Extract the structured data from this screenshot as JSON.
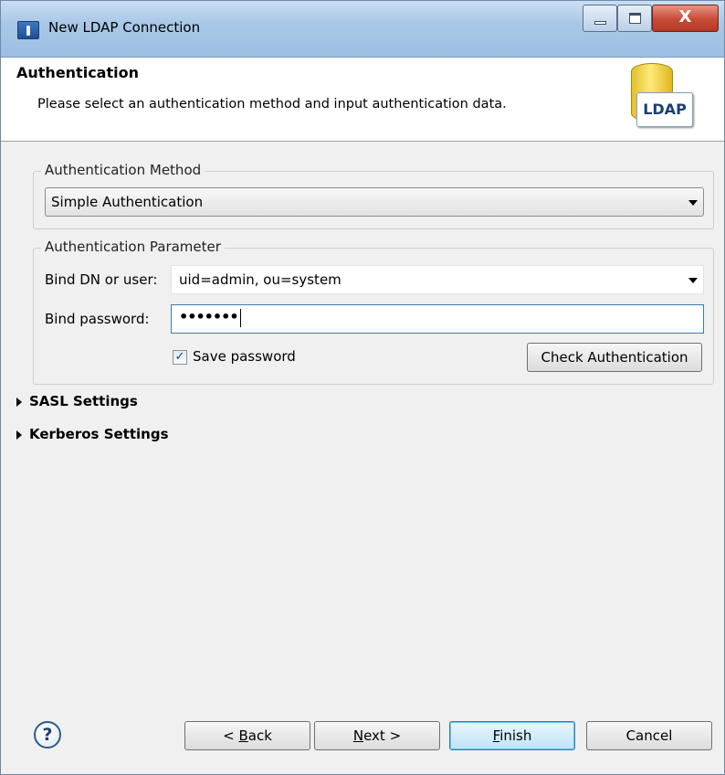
{
  "window": {
    "title": "New LDAP Connection",
    "close_glyph": "X"
  },
  "header": {
    "title": "Authentication",
    "description": "Please select an authentication method and input authentication data.",
    "logo_text": "LDAP"
  },
  "auth_method": {
    "legend": "Authentication Method",
    "selected": "Simple Authentication"
  },
  "auth_param": {
    "legend": "Authentication Parameter",
    "bind_dn_label": "Bind DN or user:",
    "bind_dn_value": "uid=admin, ou=system",
    "bind_password_label": "Bind password:",
    "bind_password_value": "•••••••",
    "save_password_label": "Save password",
    "save_password_checked": true,
    "check_button": "Check Authentication"
  },
  "sections": {
    "sasl": "SASL Settings",
    "kerberos": "Kerberos Settings"
  },
  "footer": {
    "help_glyph": "?",
    "back_prefix": "< ",
    "back_mnemonic": "B",
    "back_rest": "ack",
    "next_mnemonic": "N",
    "next_rest": "ext >",
    "finish_mnemonic": "F",
    "finish_rest": "inish",
    "cancel": "Cancel"
  },
  "colors": {
    "titlebar": "#a9c8e7",
    "close_button": "#c74a36",
    "default_button": "#bfe3f8"
  }
}
